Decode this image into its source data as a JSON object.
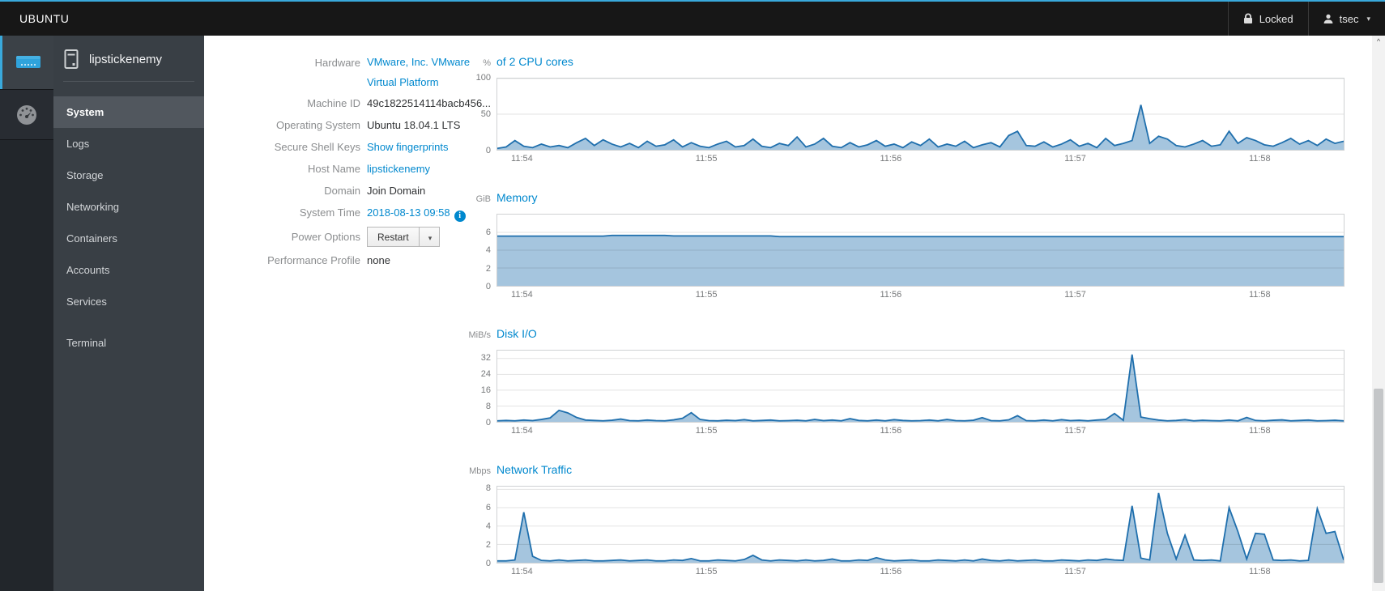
{
  "topbar": {
    "brand": "UBUNTU",
    "lock_label": "Locked",
    "user": "tsec"
  },
  "nav": {
    "host": "lipstickenemy",
    "items": [
      "System",
      "Logs",
      "Storage",
      "Networking",
      "Containers",
      "Accounts",
      "Services"
    ],
    "terminal": "Terminal",
    "selected": "System"
  },
  "info": {
    "rows": [
      {
        "label": "Hardware",
        "value": "VMware, Inc. VMware",
        "value2": "Virtual Platform",
        "link": true
      },
      {
        "label": "Machine ID",
        "value": "49c1822514114bacb456..."
      },
      {
        "label": "Operating System",
        "value": "Ubuntu 18.04.1 LTS"
      },
      {
        "label": "Secure Shell Keys",
        "value": "Show fingerprints",
        "link": true
      },
      {
        "label": "Host Name",
        "value": "lipstickenemy",
        "link": true
      },
      {
        "label": "Domain",
        "value": "Join Domain"
      },
      {
        "label": "System Time",
        "value": "2018-08-13 09:58",
        "link": true,
        "info_icon": "info-icon"
      },
      {
        "label": "Power Options",
        "button": "Restart"
      },
      {
        "label": "Performance Profile",
        "value": "none"
      }
    ]
  },
  "colors": {
    "link": "#0088ce",
    "chart_line": "#1f6fad",
    "chart_fill": "rgba(31,111,173,0.4)",
    "accent": "#39a9dc"
  },
  "chart_data": [
    {
      "id": "cpu",
      "type": "area",
      "unit": "%",
      "title": "of 2 CPU cores",
      "ylim": [
        0,
        100
      ],
      "yticks": [
        100,
        50,
        0
      ],
      "xticks": [
        "11:54",
        "11:55",
        "11:56",
        "11:57",
        "11:58"
      ],
      "values": [
        2,
        4,
        13,
        5,
        3,
        8,
        4,
        6,
        3,
        10,
        16,
        6,
        14,
        8,
        4,
        9,
        3,
        12,
        5,
        7,
        14,
        4,
        10,
        5,
        3,
        8,
        12,
        4,
        6,
        15,
        5,
        3,
        9,
        6,
        18,
        4,
        8,
        16,
        5,
        3,
        10,
        4,
        7,
        13,
        5,
        8,
        3,
        11,
        6,
        15,
        4,
        8,
        5,
        12,
        3,
        7,
        10,
        4,
        20,
        26,
        6,
        5,
        11,
        4,
        8,
        14,
        5,
        9,
        3,
        16,
        6,
        9,
        13,
        63,
        9,
        19,
        15,
        6,
        4,
        8,
        13,
        5,
        7,
        26,
        9,
        17,
        13,
        7,
        5,
        10,
        16,
        8,
        13,
        6,
        15,
        9,
        12
      ]
    },
    {
      "id": "memory",
      "type": "area",
      "unit": "GiB",
      "title": "Memory",
      "ylim": [
        0,
        8
      ],
      "yticks": [
        6,
        4,
        2,
        0
      ],
      "xticks": [
        "11:54",
        "11:55",
        "11:56",
        "11:57",
        "11:58"
      ],
      "values": [
        5.58,
        5.58,
        5.58,
        5.58,
        5.58,
        5.58,
        5.58,
        5.58,
        5.58,
        5.58,
        5.58,
        5.58,
        5.58,
        5.66,
        5.66,
        5.66,
        5.66,
        5.66,
        5.66,
        5.66,
        5.6,
        5.6,
        5.6,
        5.6,
        5.6,
        5.6,
        5.6,
        5.6,
        5.6,
        5.6,
        5.6,
        5.6,
        5.52,
        5.52,
        5.52,
        5.52,
        5.52,
        5.52,
        5.52,
        5.52,
        5.52,
        5.52,
        5.52,
        5.52,
        5.52,
        5.52,
        5.52,
        5.52,
        5.52,
        5.52,
        5.52,
        5.52,
        5.52,
        5.52,
        5.52,
        5.52,
        5.52,
        5.52,
        5.52,
        5.52,
        5.52,
        5.52,
        5.52,
        5.52,
        5.52,
        5.52,
        5.52,
        5.52,
        5.52,
        5.52,
        5.52,
        5.52,
        5.52,
        5.52,
        5.52,
        5.52,
        5.52,
        5.52,
        5.52,
        5.52,
        5.52,
        5.52,
        5.52,
        5.52,
        5.52,
        5.52,
        5.52,
        5.52,
        5.52,
        5.52,
        5.52,
        5.52,
        5.52,
        5.52,
        5.52,
        5.52,
        5.52
      ]
    },
    {
      "id": "disk-io",
      "type": "area",
      "unit": "MiB/s",
      "title": "Disk I/O",
      "ylim": [
        0,
        36
      ],
      "yticks": [
        32,
        24,
        16,
        8,
        0
      ],
      "xticks": [
        "11:54",
        "11:55",
        "11:56",
        "11:57",
        "11:58"
      ],
      "values": [
        0.5,
        0.7,
        0.5,
        0.9,
        0.6,
        1.2,
        2.0,
        5.8,
        4.5,
        2.2,
        0.9,
        0.7,
        0.5,
        0.8,
        1.4,
        0.6,
        0.5,
        0.9,
        0.6,
        0.5,
        1.0,
        1.8,
        4.6,
        1.2,
        0.6,
        0.5,
        0.8,
        0.6,
        1.1,
        0.5,
        0.7,
        0.9,
        0.5,
        0.6,
        0.8,
        0.5,
        1.2,
        0.6,
        0.9,
        0.5,
        1.6,
        0.7,
        0.5,
        0.9,
        0.5,
        1.1,
        0.7,
        0.5,
        0.6,
        0.9,
        0.5,
        1.2,
        0.6,
        0.5,
        0.8,
        2.1,
        0.6,
        0.5,
        1.0,
        3.1,
        0.6,
        0.5,
        0.9,
        0.5,
        1.1,
        0.6,
        0.8,
        0.5,
        0.9,
        1.2,
        4.2,
        0.8,
        34.0,
        2.4,
        1.6,
        0.9,
        0.5,
        0.7,
        1.1,
        0.5,
        0.8,
        0.6,
        0.5,
        0.9,
        0.5,
        2.2,
        0.7,
        0.5,
        0.8,
        1.0,
        0.5,
        0.7,
        0.9,
        0.5,
        0.6,
        0.8,
        0.5
      ]
    },
    {
      "id": "network",
      "type": "area",
      "unit": "Mbps",
      "title": "Network Traffic",
      "ylim": [
        0,
        8.3
      ],
      "yticks": [
        8,
        6,
        4,
        2,
        0
      ],
      "xticks": [
        "11:54",
        "11:55",
        "11:56",
        "11:57",
        "11:58"
      ],
      "values": [
        0.2,
        0.2,
        0.3,
        5.5,
        0.7,
        0.25,
        0.2,
        0.3,
        0.2,
        0.25,
        0.3,
        0.2,
        0.2,
        0.25,
        0.3,
        0.2,
        0.25,
        0.3,
        0.2,
        0.2,
        0.3,
        0.25,
        0.45,
        0.2,
        0.2,
        0.3,
        0.25,
        0.2,
        0.35,
        0.8,
        0.3,
        0.2,
        0.3,
        0.25,
        0.2,
        0.3,
        0.2,
        0.25,
        0.4,
        0.2,
        0.2,
        0.3,
        0.25,
        0.55,
        0.3,
        0.2,
        0.25,
        0.3,
        0.2,
        0.2,
        0.3,
        0.25,
        0.2,
        0.3,
        0.2,
        0.4,
        0.25,
        0.2,
        0.3,
        0.2,
        0.25,
        0.3,
        0.2,
        0.2,
        0.3,
        0.25,
        0.2,
        0.3,
        0.25,
        0.4,
        0.3,
        0.25,
        6.2,
        0.5,
        0.3,
        7.6,
        3.2,
        0.4,
        3.0,
        0.3,
        0.25,
        0.3,
        0.2,
        6.0,
        3.4,
        0.4,
        3.2,
        3.1,
        0.3,
        0.25,
        0.3,
        0.2,
        0.25,
        5.9,
        3.2,
        3.4,
        0.3
      ]
    }
  ],
  "scroll": {
    "up_arrow": "^"
  }
}
